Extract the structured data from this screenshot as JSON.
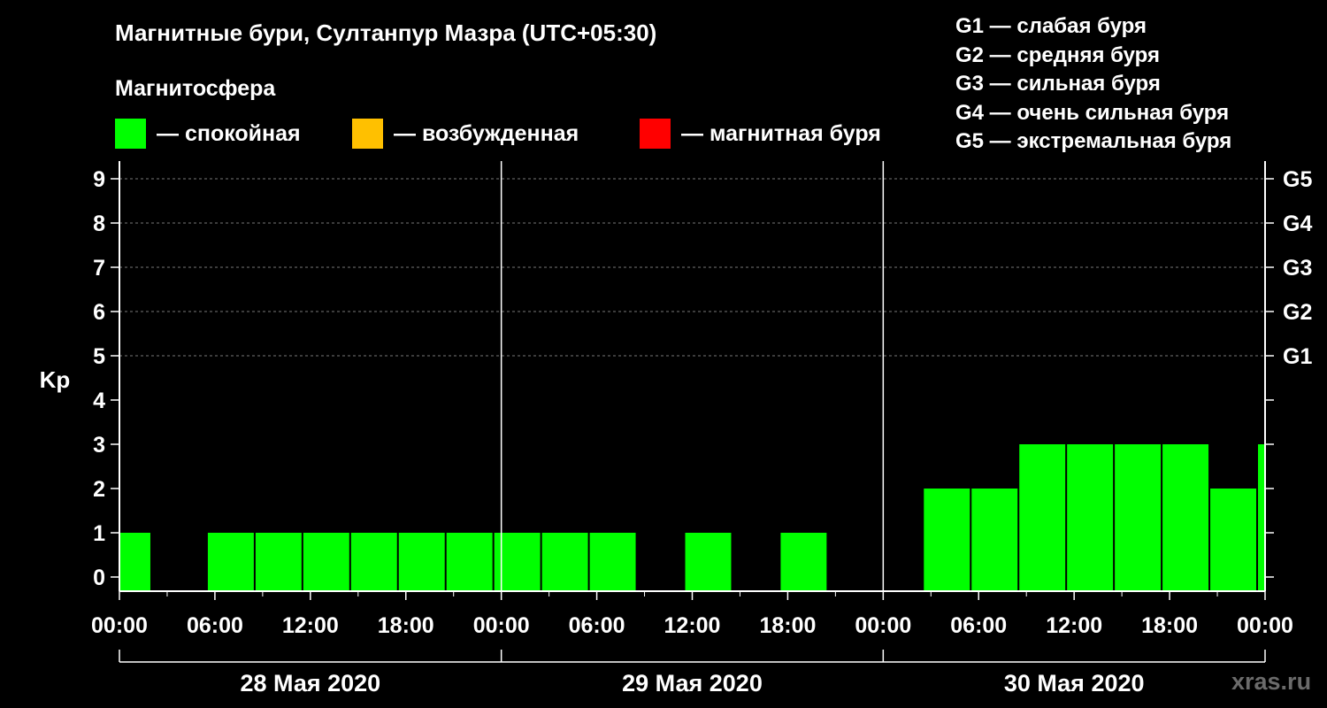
{
  "header": {
    "title": "Магнитные бури, Султанпур Мазра (UTC+05:30)",
    "subtitle": "Магнитосфера"
  },
  "legend": [
    {
      "label": "— спокойная",
      "color": "#00ff00"
    },
    {
      "label": "— возбужденная",
      "color": "#ffc000"
    },
    {
      "label": "— магнитная буря",
      "color": "#ff0000"
    }
  ],
  "gscale": [
    "G1 — слабая буря",
    "G2 — средняя буря",
    "G3 — сильная буря",
    "G4 — очень сильная буря",
    "G5 — экстремальная буря"
  ],
  "watermark": "xras.ru",
  "chart_data": {
    "type": "bar",
    "ylabel": "Kp",
    "ylim": [
      0,
      9
    ],
    "y_ticks": [
      "0",
      "1",
      "2",
      "3",
      "4",
      "5",
      "6",
      "7",
      "8",
      "9"
    ],
    "g_levels": [
      {
        "kp": 5,
        "label": "G1"
      },
      {
        "kp": 6,
        "label": "G2"
      },
      {
        "kp": 7,
        "label": "G3"
      },
      {
        "kp": 8,
        "label": "G4"
      },
      {
        "kp": 9,
        "label": "G5"
      }
    ],
    "grid": true,
    "x_ticks_hours": [
      0,
      6,
      12,
      18,
      24,
      30,
      36,
      42,
      48,
      54,
      60,
      66,
      72
    ],
    "x_tick_labels": [
      "00:00",
      "06:00",
      "12:00",
      "18:00",
      "00:00",
      "06:00",
      "12:00",
      "18:00",
      "00:00",
      "06:00",
      "12:00",
      "18:00",
      "00:00"
    ],
    "days": [
      {
        "label": "28 Мая 2020",
        "start_hour": 0,
        "end_hour": 24
      },
      {
        "label": "29 Мая 2020",
        "start_hour": 24,
        "end_hour": 48
      },
      {
        "label": "30 Мая 2020",
        "start_hour": 48,
        "end_hour": 72
      }
    ],
    "bars": [
      {
        "start": 0,
        "end": 2,
        "kp": 1,
        "color": "#00ff00"
      },
      {
        "start": 5.5,
        "end": 8.5,
        "kp": 1,
        "color": "#00ff00"
      },
      {
        "start": 8.5,
        "end": 11.5,
        "kp": 1,
        "color": "#00ff00"
      },
      {
        "start": 11.5,
        "end": 14.5,
        "kp": 1,
        "color": "#00ff00"
      },
      {
        "start": 14.5,
        "end": 17.5,
        "kp": 1,
        "color": "#00ff00"
      },
      {
        "start": 17.5,
        "end": 20.5,
        "kp": 1,
        "color": "#00ff00"
      },
      {
        "start": 20.5,
        "end": 23.5,
        "kp": 1,
        "color": "#00ff00"
      },
      {
        "start": 23.5,
        "end": 26.5,
        "kp": 1,
        "color": "#00ff00"
      },
      {
        "start": 26.5,
        "end": 29.5,
        "kp": 1,
        "color": "#00ff00"
      },
      {
        "start": 29.5,
        "end": 32.5,
        "kp": 1,
        "color": "#00ff00"
      },
      {
        "start": 35.5,
        "end": 38.5,
        "kp": 1,
        "color": "#00ff00"
      },
      {
        "start": 41.5,
        "end": 44.5,
        "kp": 1,
        "color": "#00ff00"
      },
      {
        "start": 50.5,
        "end": 53.5,
        "kp": 2,
        "color": "#00ff00"
      },
      {
        "start": 53.5,
        "end": 56.5,
        "kp": 2,
        "color": "#00ff00"
      },
      {
        "start": 56.5,
        "end": 59.5,
        "kp": 3,
        "color": "#00ff00"
      },
      {
        "start": 59.5,
        "end": 62.5,
        "kp": 3,
        "color": "#00ff00"
      },
      {
        "start": 62.5,
        "end": 65.5,
        "kp": 3,
        "color": "#00ff00"
      },
      {
        "start": 65.5,
        "end": 68.5,
        "kp": 3,
        "color": "#00ff00"
      },
      {
        "start": 68.5,
        "end": 71.5,
        "kp": 2,
        "color": "#00ff00"
      },
      {
        "start": 71.5,
        "end": 72,
        "kp": 3,
        "color": "#00ff00"
      }
    ]
  }
}
